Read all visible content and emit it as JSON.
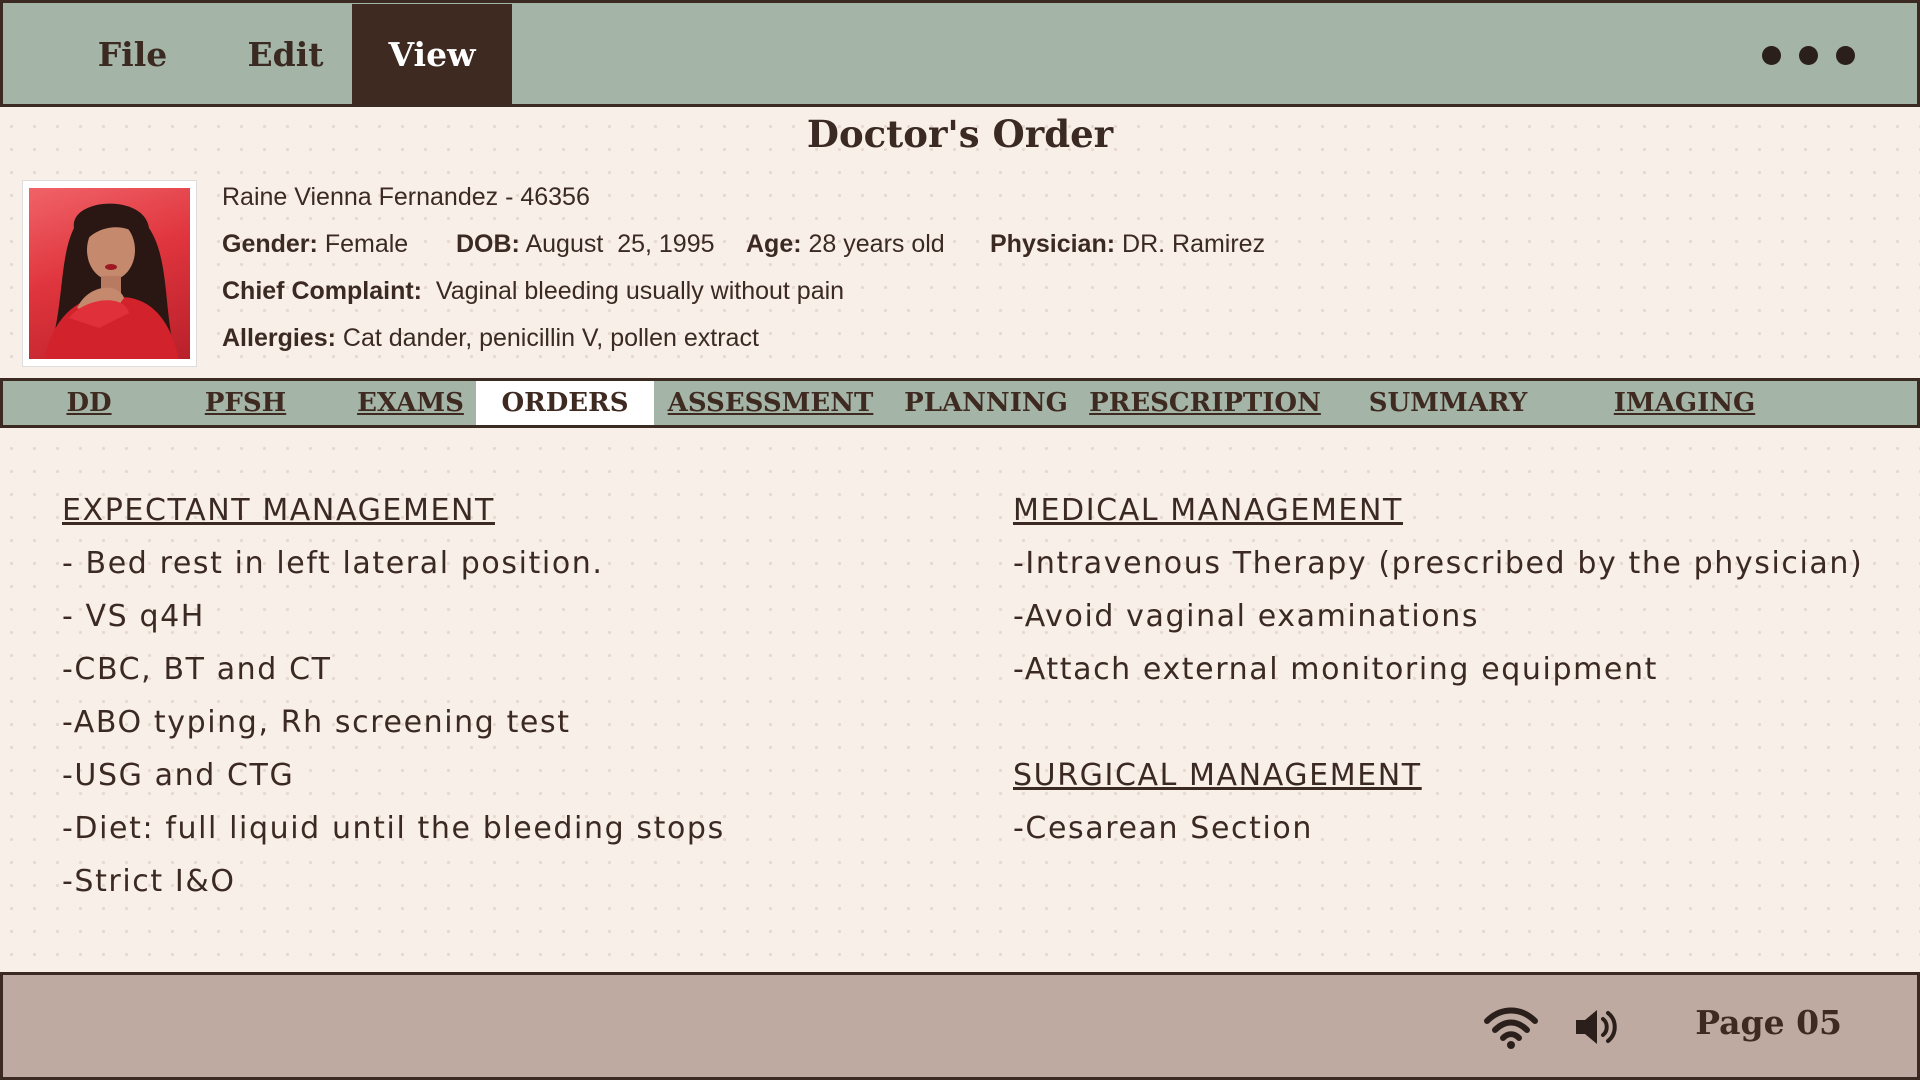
{
  "menu": {
    "file": "File",
    "edit": "Edit",
    "view": "View"
  },
  "title": "Doctor's Order",
  "patient": {
    "name_id": "Raine Vienna Fernandez - 46356",
    "gender_label": "Gender:",
    "gender": "Female",
    "dob_label": "DOB:",
    "dob": "August  25, 1995",
    "age_label": "Age:",
    "age": "28 years old",
    "physician_label": "Physician:",
    "physician": "DR. Ramirez",
    "complaint_label": "Chief Complaint:",
    "complaint": "Vaginal bleeding usually without pain",
    "allergies_label": "Allergies:",
    "allergies": "Cat dander, penicillin V, pollen extract"
  },
  "tabs": [
    "DD",
    "PFSH",
    "EXAMS",
    "ORDERS",
    "ASSESSMENT",
    "PLANNING",
    "PRESCRIPTION",
    "SUMMARY",
    "IMAGING"
  ],
  "active_tab": "ORDERS",
  "expectant": {
    "title": "EXPECTANT MANAGEMENT",
    "items": [
      "- Bed rest in left lateral position.",
      "- VS q4H",
      "-CBC, BT and CT",
      "-ABO typing, Rh screening test",
      "-USG and CTG",
      "-Diet: full liquid until the bleeding stops",
      "-Strict I&O"
    ]
  },
  "medical": {
    "title": "MEDICAL MANAGEMENT",
    "items": [
      "-Intravenous Therapy (prescribed by the physician)",
      "-Avoid vaginal examinations",
      "-Attach external monitoring equipment"
    ]
  },
  "surgical": {
    "title": "SURGICAL MANAGEMENT",
    "items": [
      "-Cesarean Section"
    ]
  },
  "status": {
    "wifi_icon": "wifi-icon",
    "speaker_icon": "speaker-icon",
    "page": "Page 05"
  },
  "colors": {
    "menubar": "#a4b4a6",
    "active_menu": "#3e2a21",
    "background": "#f9efe9",
    "statusbar": "#bfaaa2"
  }
}
